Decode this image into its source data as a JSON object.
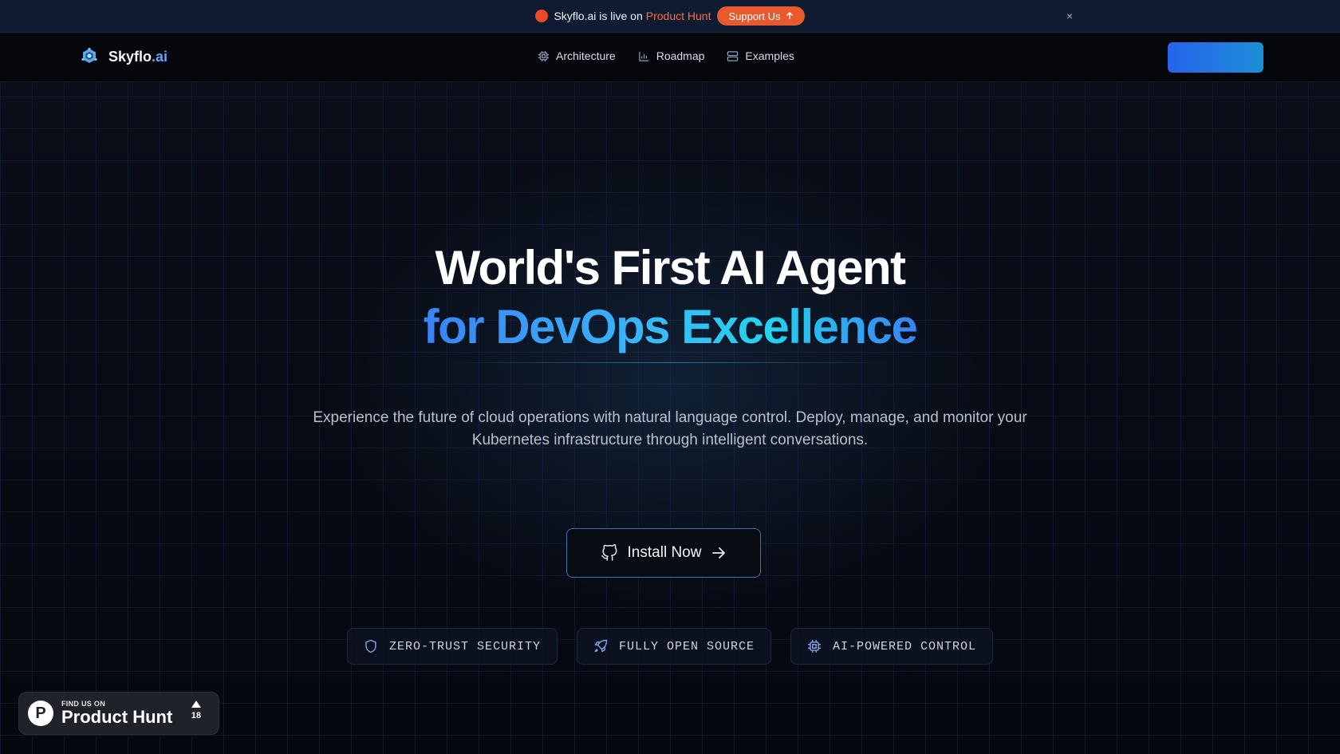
{
  "announcement": {
    "text": "Skyflo.ai is live on",
    "highlight": "Product Hunt",
    "button_label": "Support Us",
    "button_icon": "arrow-up-icon",
    "close_icon": "×"
  },
  "nav": {
    "brand_main": "Skyflo",
    "brand_suffix": ".ai",
    "links": [
      {
        "label": "Architecture",
        "icon": "cpu-icon"
      },
      {
        "label": "Roadmap",
        "icon": "bar-chart-icon"
      },
      {
        "label": "Examples",
        "icon": "server-icon"
      }
    ],
    "cta_label": ""
  },
  "hero": {
    "title_line1": "World's First AI Agent",
    "title_line2": "for DevOps Excellence",
    "subtitle": "Experience the future of cloud operations with natural language control. Deploy, manage, and monitor your Kubernetes infrastructure through intelligent conversations.",
    "install_label": "Install Now",
    "features": [
      {
        "label": "ZERO-TRUST SECURITY",
        "icon": "shield-icon"
      },
      {
        "label": "FULLY OPEN SOURCE",
        "icon": "rocket-icon"
      },
      {
        "label": "AI-POWERED CONTROL",
        "icon": "cpu-icon"
      }
    ]
  },
  "product_hunt_badge": {
    "logo_letter": "P",
    "small_text": "FIND US ON",
    "big_text": "Product Hunt",
    "votes": "18"
  },
  "colors": {
    "accent_blue": "#3b82f6",
    "accent_cyan": "#22d3ee",
    "product_hunt_orange": "#ea4b26"
  }
}
